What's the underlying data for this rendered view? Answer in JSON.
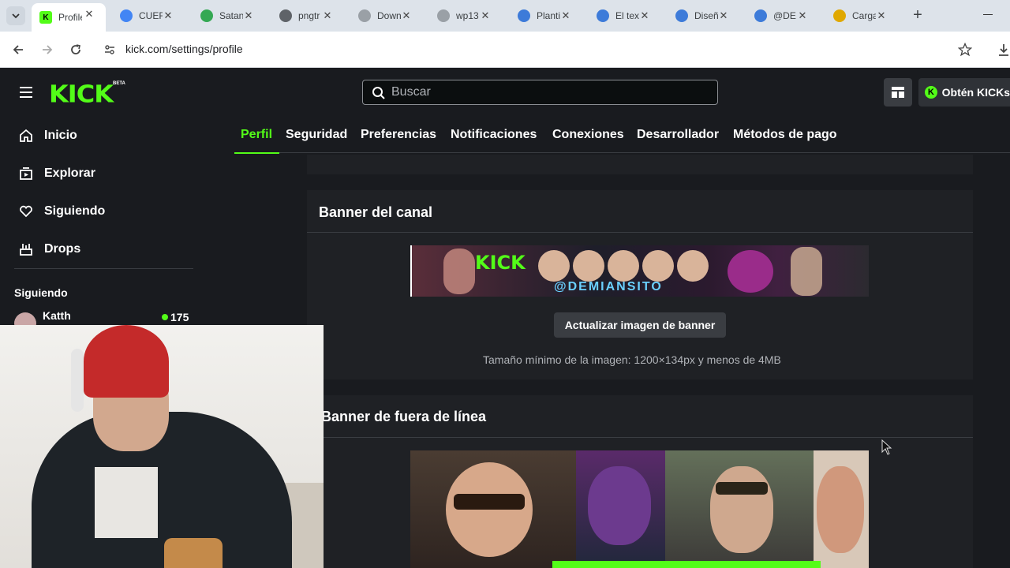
{
  "browser": {
    "tabs": [
      {
        "title": "Profile",
        "icon": "kick-favicon",
        "color": "#53fc18",
        "active": true
      },
      {
        "title": "CUER",
        "icon": "google-favicon",
        "color": "#4285f4"
      },
      {
        "title": "Satan",
        "icon": "green-circle-favicon",
        "color": "#34a853"
      },
      {
        "title": "pngtr",
        "icon": "globe-favicon",
        "color": "#5f6368"
      },
      {
        "title": "Down",
        "icon": "w-favicon",
        "color": "#9aa0a6"
      },
      {
        "title": "wp13",
        "icon": "w-favicon",
        "color": "#9aa0a6"
      },
      {
        "title": "Planti",
        "icon": "canva-favicon",
        "color": "#3d7bd9"
      },
      {
        "title": "El tex",
        "icon": "canva-favicon",
        "color": "#3d7bd9"
      },
      {
        "title": "Diseñ",
        "icon": "canva-favicon",
        "color": "#3d7bd9"
      },
      {
        "title": "@DE",
        "icon": "canva-favicon",
        "color": "#3d7bd9"
      },
      {
        "title": "Carga",
        "icon": "hat-favicon",
        "color": "#e0a800"
      }
    ],
    "url": "kick.com/settings/profile"
  },
  "header": {
    "logo": "KICK",
    "beta": "BETA",
    "search_placeholder": "Buscar",
    "kicks_button": "Obtén KICKs"
  },
  "sidebar": {
    "items": [
      {
        "label": "Inicio",
        "icon": "home-icon"
      },
      {
        "label": "Explorar",
        "icon": "explore-icon"
      },
      {
        "label": "Siguiendo",
        "icon": "heart-icon"
      },
      {
        "label": "Drops",
        "icon": "drops-icon"
      }
    ],
    "following_heading": "Siguiendo",
    "following": [
      {
        "name": "Katth",
        "viewers": "175"
      }
    ]
  },
  "settings_tabs": [
    "Perfil",
    "Seguridad",
    "Preferencias",
    "Notificaciones",
    "Conexiones",
    "Desarrollador",
    "Métodos de pago"
  ],
  "banner_section": {
    "title": "Banner del canal",
    "banner_text": "KICK",
    "banner_handle": "@DEMIANSITO",
    "button": "Actualizar imagen de banner",
    "hint": "Tamaño mínimo de la imagen: 1200×134px y menos de 4MB"
  },
  "offline_section": {
    "title": "Banner de fuera de línea"
  },
  "colors": {
    "accent": "#53fc18",
    "background": "#191b1f",
    "card": "#1f2125"
  }
}
